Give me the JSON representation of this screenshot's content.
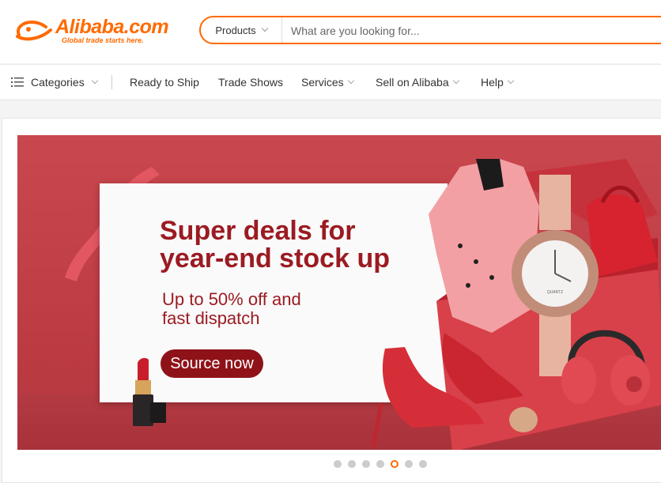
{
  "header": {
    "logo_text": "Alibaba.com",
    "logo_tagline": "Global trade starts here.",
    "search": {
      "category": "Products",
      "placeholder": "What are you looking for..."
    }
  },
  "nav": {
    "categories": "Categories",
    "ready_to_ship": "Ready to Ship",
    "trade_shows": "Trade Shows",
    "services": "Services",
    "sell_on_alibaba": "Sell on Alibaba",
    "help": "Help"
  },
  "banner": {
    "headline_line1": "Super deals for",
    "headline_line2": "year-end stock up",
    "sub_line1": "Up to 50% off and",
    "sub_line2": "fast dispatch",
    "cta": "Source now",
    "watch_brand": "QUARTZ"
  },
  "carousel": {
    "count": 7,
    "active_index": 4
  },
  "colors": {
    "brand": "#ff6a00",
    "banner_bg": "#c9474e",
    "headline": "#9b1b22",
    "cta_bg": "#8f1219"
  },
  "icons": [
    "alibaba-logo-icon",
    "menu-icon",
    "chevron-down-icon"
  ]
}
